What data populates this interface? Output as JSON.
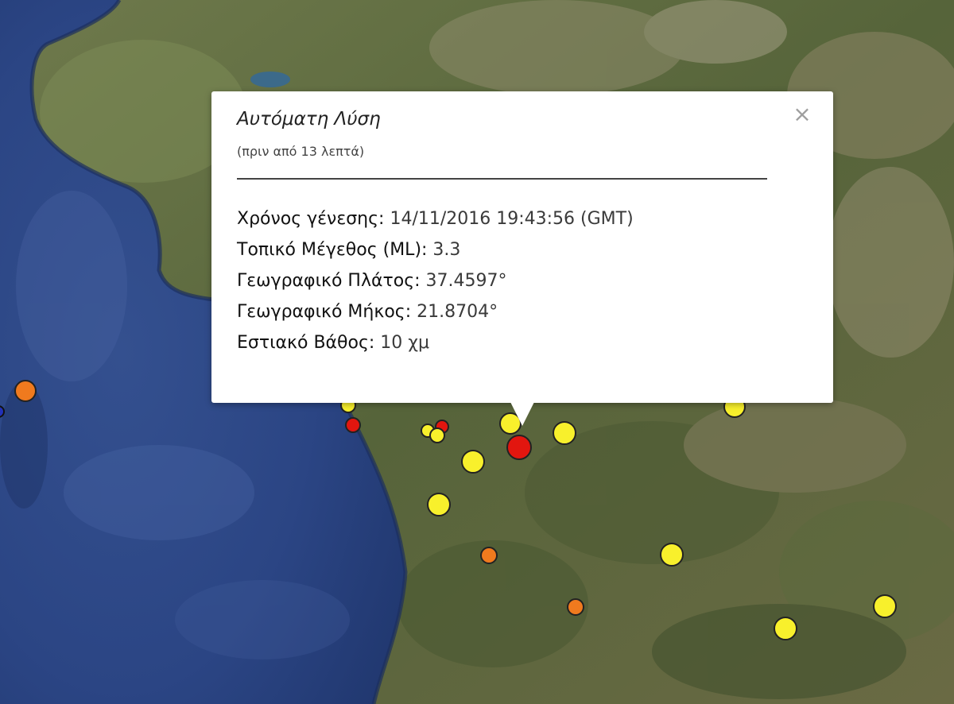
{
  "popup": {
    "title": "Αυτόματη Λύση",
    "subtitle": "(πριν από 13 λεπτά)",
    "close_label": "×",
    "fields": [
      {
        "label": "Χρόνος γένεσης:",
        "value": " 14/11/2016  19:43:56 (GMT)"
      },
      {
        "label": "Τοπικό Μέγεθος (ML):",
        "value": " 3.3"
      },
      {
        "label": "Γεωγραφικό Πλάτος:",
        "value": " 37.4597°"
      },
      {
        "label": "Γεωγραφικό Μήκος:",
        "value": " 21.8704°"
      },
      {
        "label": "Εστιακό Βάθος:",
        "value": " 10 χμ"
      }
    ]
  },
  "colors": {
    "sea": "#2e4a87",
    "land": "#5b6a3c",
    "marker_red": "#e2160f",
    "marker_yellow": "#f8f02c",
    "marker_orange": "#f07a1e",
    "marker_blue": "#2231b8"
  },
  "markers": [
    {
      "name": "epicenter-current",
      "color": "red",
      "size": "large"
    },
    {
      "name": "event",
      "color": "yellow"
    },
    {
      "name": "event",
      "color": "yellow"
    },
    {
      "name": "event",
      "color": "yellow"
    },
    {
      "name": "event",
      "color": "yellow"
    },
    {
      "name": "event",
      "color": "orange"
    },
    {
      "name": "event",
      "color": "orange"
    },
    {
      "name": "event",
      "color": "red"
    },
    {
      "name": "event",
      "color": "blue"
    }
  ]
}
